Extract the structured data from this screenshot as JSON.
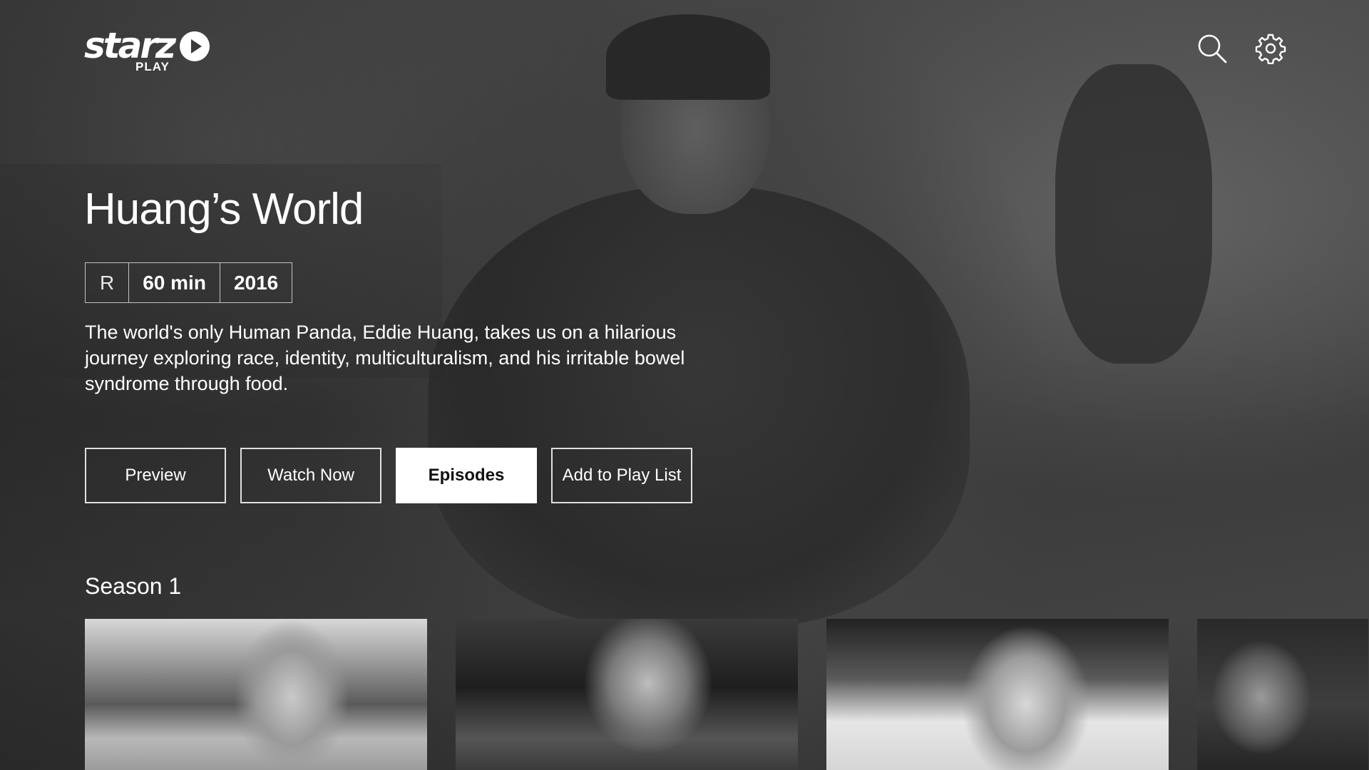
{
  "brand": {
    "wordmark": "starz",
    "sub": "PLAY"
  },
  "header": {
    "icons": [
      "search-icon",
      "gear-icon"
    ]
  },
  "show": {
    "title": "Huang’s World",
    "rating": "R",
    "duration": "60 min",
    "year": "2016",
    "description": "The world's only Human Panda, Eddie Huang, takes us on a hilarious journey exploring race, identity, multiculturalism, and his irritable bowel syndrome through food."
  },
  "actions": {
    "preview": "Preview",
    "watch_now": "Watch Now",
    "episodes": "Episodes",
    "add_to_playlist": "Add to Play List",
    "focused": "episodes"
  },
  "season": {
    "label": "Season 1"
  },
  "colors": {
    "focused_button_bg": "#ffffff",
    "focused_button_text": "#111111",
    "text": "#ffffff"
  }
}
